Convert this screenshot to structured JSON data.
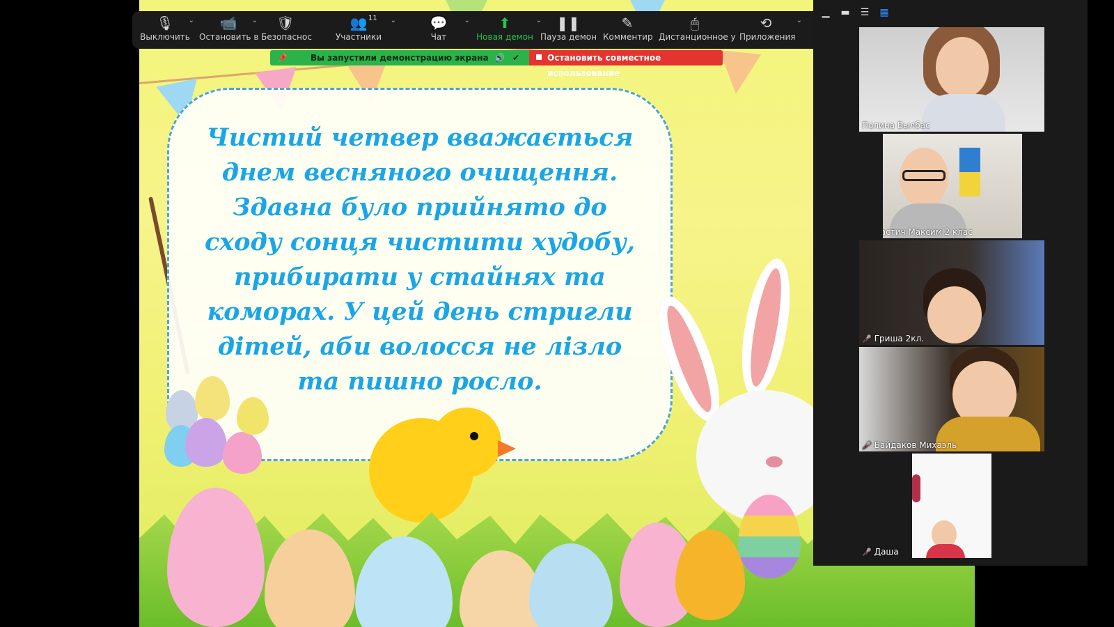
{
  "toolbar": {
    "mute": "Выключить",
    "stop_video": "Остановить в",
    "security": "Безопаснос",
    "participants": "Участники",
    "participants_count": "11",
    "chat": "Чат",
    "new_share": "Новая демон",
    "pause_share": "Пауза демон",
    "annotate": "Комментир",
    "remote_control": "Дистанционное у",
    "apps": "Приложения"
  },
  "share_banner": {
    "status": "Вы запустили демонстрацию экрана",
    "stop": "Остановить совместное использование"
  },
  "slide": {
    "lines": [
      "Чистий четвер вважається",
      "днем весняного очищення.",
      "Здавна було прийнято до",
      "сходу сонця чистити худобу,",
      "прибирати у стайнях та",
      "коморах. У цей день стригли",
      "дітей, аби волосся не лізло",
      "та пишно росло."
    ]
  },
  "gallery": {
    "participants": [
      {
        "name": "Полина Былбас",
        "muted": false
      },
      {
        "name": "Настич Максим 2 клас",
        "muted": true
      },
      {
        "name": "Гриша 2кл.",
        "muted": true
      },
      {
        "name": "Байдаков Михаэль",
        "muted": true
      },
      {
        "name": "Даша",
        "muted": true
      }
    ]
  },
  "colors": {
    "slide_text": "#1aa6e6",
    "share_green": "#2bb34a",
    "share_red": "#e3342f",
    "toolbar_bg": "#1b1b1b"
  }
}
